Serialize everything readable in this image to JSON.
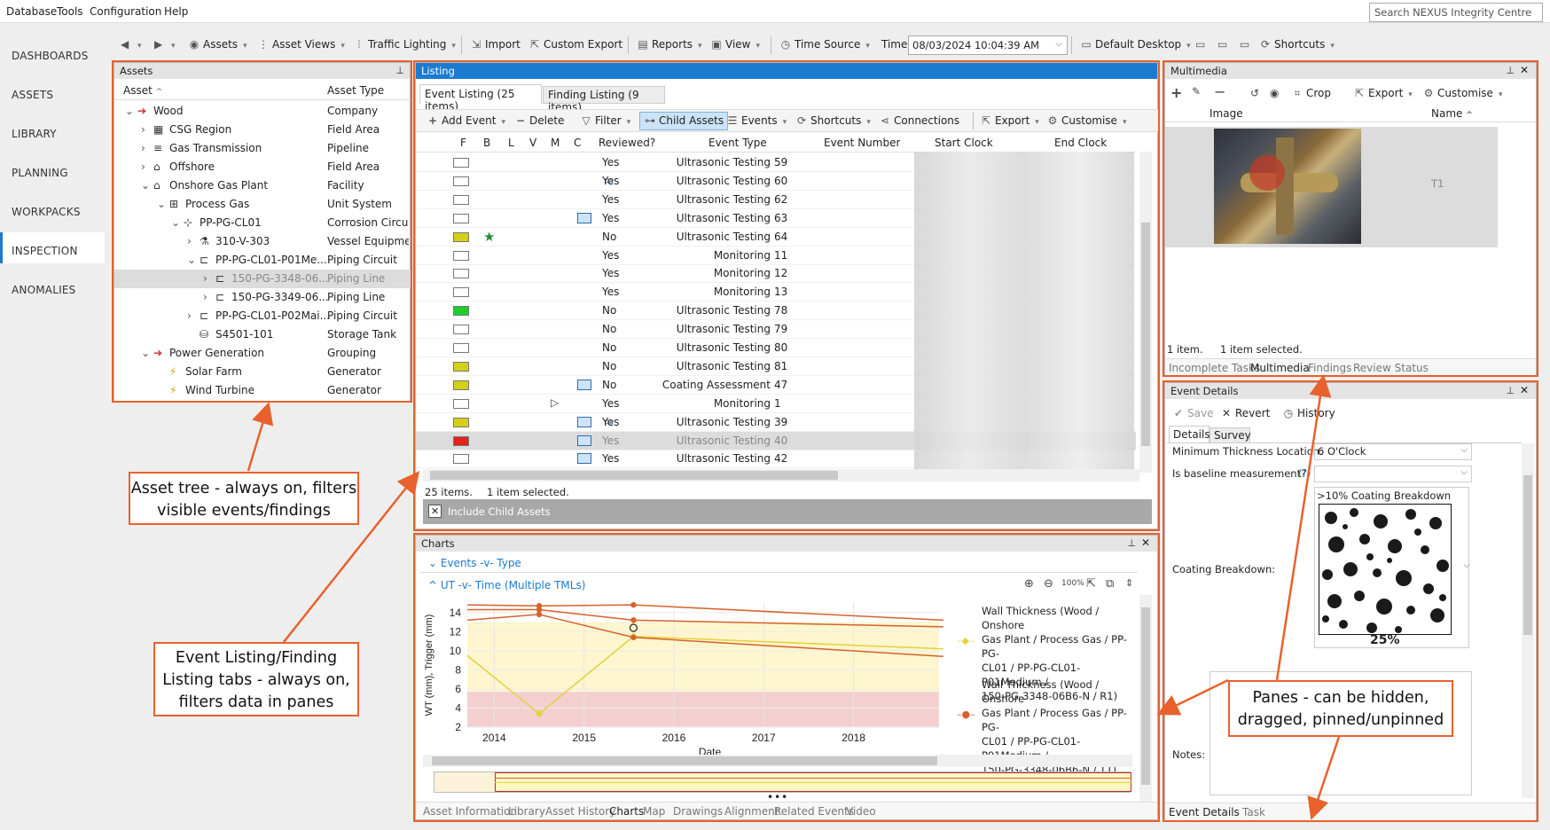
{
  "menu": [
    "Database",
    "Tools",
    "Configuration",
    "Help"
  ],
  "search_placeholder": "Search NEXUS Integrity Centre",
  "nav": [
    "DASHBOARDS",
    "ASSETS",
    "LIBRARY",
    "PLANNING",
    "WORKPACKS",
    "INSPECTION",
    "ANOMALIES"
  ],
  "toolbar": {
    "assets": "Assets",
    "asset_views": "Asset Views",
    "traffic": "Traffic Lighting",
    "import": "Import",
    "custom_export": "Custom Export",
    "reports": "Reports",
    "view": "View",
    "time_source": "Time Source",
    "time": "Time",
    "time_value": "08/03/2024 10:04:39 AM",
    "desktop": "Default Desktop",
    "shortcuts": "Shortcuts"
  },
  "assets_pane": {
    "title": "Assets",
    "col_asset": "Asset",
    "col_type": "Asset Type",
    "rows": [
      {
        "name": "Wood",
        "type": "Company"
      },
      {
        "name": "CSG Region",
        "type": "Field Area"
      },
      {
        "name": "Gas Transmission",
        "type": "Pipeline"
      },
      {
        "name": "Offshore",
        "type": "Field Area"
      },
      {
        "name": "Onshore Gas Plant",
        "type": "Facility"
      },
      {
        "name": "Process Gas",
        "type": "Unit System"
      },
      {
        "name": "PP-PG-CL01",
        "type": "Corrosion Circu..."
      },
      {
        "name": "310-V-303",
        "type": "Vessel Equipme..."
      },
      {
        "name": "PP-PG-CL01-P01Me...",
        "type": "Piping Circuit"
      },
      {
        "name": "150-PG-3348-06...",
        "type": "Piping Line"
      },
      {
        "name": "150-PG-3349-06...",
        "type": "Piping Line"
      },
      {
        "name": "PP-PG-CL01-P02Mai...",
        "type": "Piping Circuit"
      },
      {
        "name": "S4501-101",
        "type": "Storage Tank"
      },
      {
        "name": "Power Generation",
        "type": "Grouping"
      },
      {
        "name": "Solar Farm",
        "type": "Generator"
      },
      {
        "name": "Wind Turbine",
        "type": "Generator"
      }
    ]
  },
  "listing": {
    "title": "Listing",
    "tab1": "Event Listing (25 items)",
    "tab2": "Finding Listing (9 items)",
    "actions": {
      "add": "Add Event",
      "delete": "Delete",
      "filter": "Filter",
      "child": "Child Assets",
      "events": "Events",
      "shortcuts": "Shortcuts",
      "connections": "Connections",
      "export": "Export",
      "customise": "Customise"
    },
    "headers": [
      "F",
      "B",
      "L",
      "V",
      "M",
      "C",
      "Reviewed?",
      "Event Type",
      "Event Number",
      "Start Clock",
      "End Clock"
    ],
    "rows": [
      {
        "rev": "Yes",
        "type": "Ultrasonic Testing",
        "num": "59",
        "color": "#ffffff"
      },
      {
        "rev": "Yes",
        "type": "Ultrasonic Testing",
        "num": "60",
        "color": "#ffffff"
      },
      {
        "rev": "Yes",
        "type": "Ultrasonic Testing",
        "num": "62",
        "color": "#ffffff"
      },
      {
        "rev": "Yes",
        "type": "Ultrasonic Testing",
        "num": "63",
        "color": "#ffffff"
      },
      {
        "rev": "No",
        "type": "Ultrasonic Testing",
        "num": "64",
        "color": "#d4d018"
      },
      {
        "rev": "Yes",
        "type": "Monitoring",
        "num": "11",
        "color": "#ffffff"
      },
      {
        "rev": "Yes",
        "type": "Monitoring",
        "num": "12",
        "color": "#ffffff"
      },
      {
        "rev": "Yes",
        "type": "Monitoring",
        "num": "13",
        "color": "#ffffff"
      },
      {
        "rev": "No",
        "type": "Ultrasonic Testing",
        "num": "78",
        "color": "#1fce2a"
      },
      {
        "rev": "No",
        "type": "Ultrasonic Testing",
        "num": "79",
        "color": "#ffffff"
      },
      {
        "rev": "No",
        "type": "Ultrasonic Testing",
        "num": "80",
        "color": "#ffffff"
      },
      {
        "rev": "No",
        "type": "Ultrasonic Testing",
        "num": "81",
        "color": "#d4d018"
      },
      {
        "rev": "No",
        "type": "Coating Assessment",
        "num": "47",
        "color": "#d4d018"
      },
      {
        "rev": "Yes",
        "type": "Monitoring",
        "num": "1",
        "color": "#ffffff"
      },
      {
        "rev": "Yes",
        "type": "Ultrasonic Testing",
        "num": "39",
        "color": "#d4d018"
      },
      {
        "rev": "Yes",
        "type": "Ultrasonic Testing",
        "num": "40",
        "color": "#e0241a"
      },
      {
        "rev": "Yes",
        "type": "Ultrasonic Testing",
        "num": "42",
        "color": "#ffffff"
      }
    ],
    "status_items": "25 items.",
    "status_sel": "1 item selected.",
    "include": "Include Child Assets"
  },
  "charts": {
    "title": "Charts",
    "sec1": "Events -v- Type",
    "sec2": "UT -v- Time (Multiple TMLs)",
    "ylabel": "WT (mm), Trigger (mm)",
    "xlabel": "Date",
    "legend1": [
      "Wall Thickness (Wood / Onshore",
      "Gas Plant / Process Gas / PP-PG-",
      "CL01 / PP-PG-CL01-P01Medium /",
      "150-PG-3348-06B6-N / R1)"
    ],
    "legend2": [
      "Wall Thickness (Wood / Onshore",
      "Gas Plant / Process Gas / PP-PG-",
      "CL01 / PP-PG-CL01-P01Medium /",
      "150-PG-3348-06B6-N / T1)"
    ],
    "tabs": [
      "Asset Information",
      "Library",
      "Asset History",
      "Charts",
      "Map",
      "Drawings",
      "Alignment",
      "Related Events",
      "Video"
    ]
  },
  "chart_data": {
    "type": "line",
    "ylim": [
      2,
      15
    ],
    "xlim": [
      2013.7,
      2019.1
    ],
    "yticks": [
      2,
      4,
      6,
      8,
      10,
      12,
      14
    ],
    "xticks": [
      "2014",
      "2015",
      "2016",
      "2017",
      "2018"
    ],
    "bands": [
      {
        "from": 2,
        "to": 5.7,
        "color": "#f3cfd0"
      },
      {
        "from": 5.7,
        "to": 13,
        "color": "#fdf6cf"
      }
    ],
    "series": [
      {
        "name": "Wall Thickness (Wood / Onshore Gas Plant / Process Gas / PP-PG-CL01 / PP-PG-CL01-P01Medium / 150-PG-3348-06B6-N / R1)",
        "color": "#e5d13a",
        "x": [
          2013.7,
          2014.5,
          2015.55,
          2019
        ],
        "y": [
          9.5,
          3.4,
          11.5,
          10.2
        ]
      },
      {
        "name": "Wall Thickness (Wood / Onshore Gas Plant / Process Gas / PP-PG-CL01 / PP-PG-CL01-P01Medium / 150-PG-3348-06B6-N / T1)",
        "color": "#d6622b",
        "x": [
          2013.7,
          2014.5,
          2015.55,
          2019
        ],
        "y": [
          14.8,
          14.7,
          14.8,
          13.2
        ]
      },
      {
        "name": "",
        "color": "#d6622b",
        "x": [
          2013.7,
          2014.5,
          2015.55,
          2019
        ],
        "y": [
          14.3,
          14.3,
          13.2,
          12.5
        ]
      },
      {
        "name": "",
        "color": "#d6622b",
        "x": [
          2013.7,
          2014.5,
          2015.55,
          2019
        ],
        "y": [
          13.2,
          13.8,
          11.4,
          9.4
        ]
      }
    ]
  },
  "multimedia": {
    "title": "Multimedia",
    "crop": "Crop",
    "export": "Export",
    "customise": "Customise",
    "col_image": "Image",
    "col_name": "Name",
    "item_name": "T1",
    "status_items": "1 item.",
    "status_sel": "1 item selected.",
    "tabs": [
      "Incomplete Tasks",
      "Multimedia",
      "Findings",
      "Review Status"
    ]
  },
  "event_details": {
    "title": "Event Details",
    "save": "Save",
    "revert": "Revert",
    "history": "History",
    "tab1": "Details",
    "tab2": "Survey",
    "min_thick_label": "Minimum Thickness Location:",
    "min_thick_value": "6 O'Clock",
    "baseline_label": "Is baseline measurement?:",
    "baseline_help": "(?)",
    "coating_label": "Coating Breakdown:",
    "coating_title": ">10% Coating Breakdown",
    "coating_pct": "25%",
    "notes_label": "Notes:",
    "tabs": [
      "Event Details",
      "Task"
    ]
  },
  "callouts": {
    "c1": "Asset tree - always on, filters visible events/findings",
    "c2": "Event Listing/Finding Listing tabs - always on, filters data in panes",
    "c3": "Panes - can be hidden, dragged, pinned/unpinned"
  }
}
